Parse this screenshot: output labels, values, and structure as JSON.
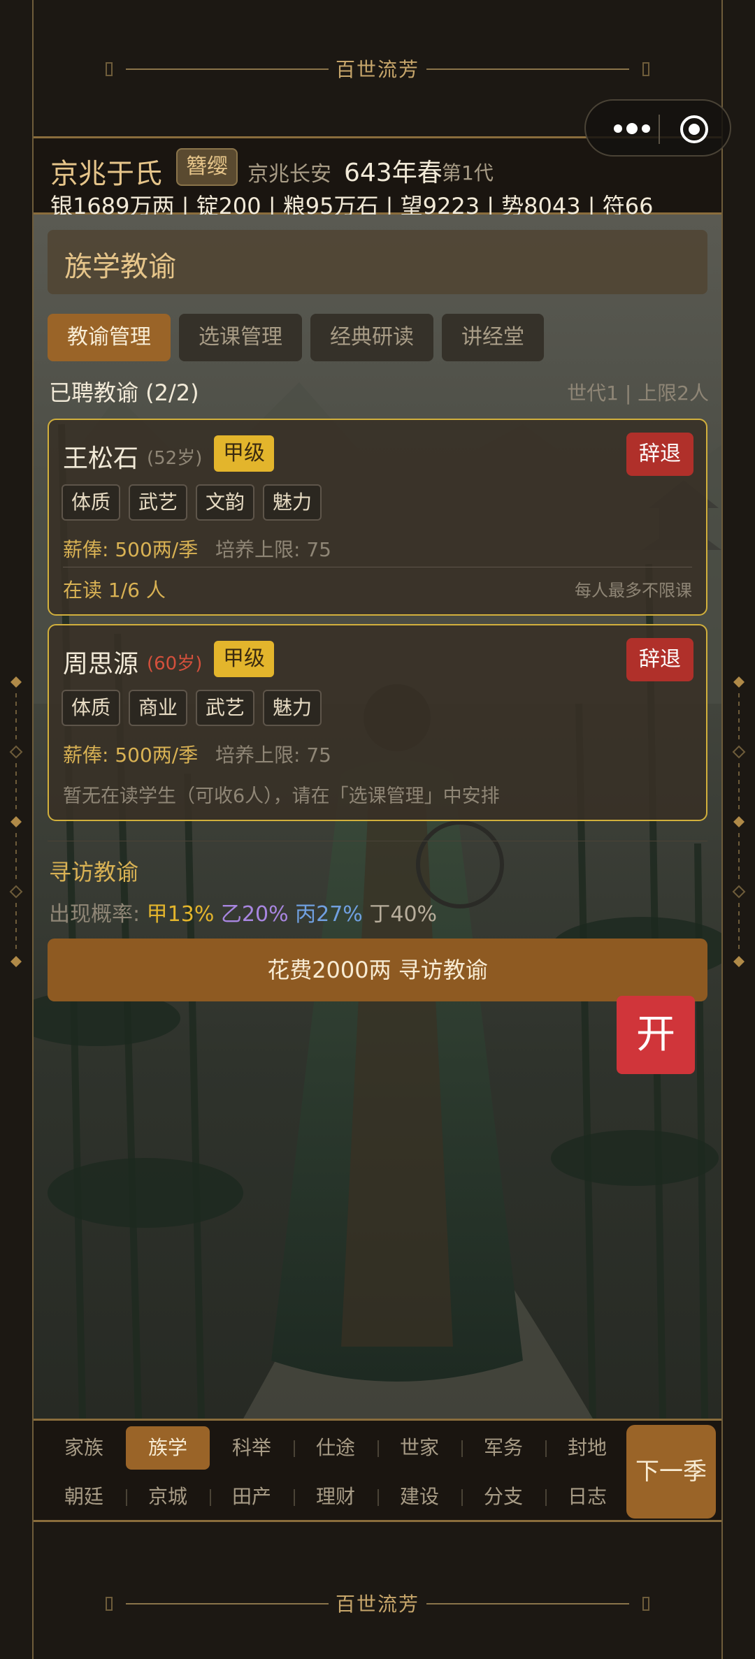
{
  "banner": {
    "title": "百世流芳"
  },
  "capsule": {
    "menu_icon": "more-dots-icon",
    "close_icon": "target-circle-icon"
  },
  "header": {
    "clan_name": "京兆于氏",
    "rank": "簪缨",
    "location": "京兆长安",
    "year": "643年春",
    "generation": "第1代",
    "stats": "银1689万两 | 锭200 | 粮95万石 | 望9223 | 势8043 | 符66"
  },
  "panel": {
    "title": "族学教谕",
    "tabs": [
      {
        "label": "教谕管理",
        "active": true
      },
      {
        "label": "选课管理",
        "active": false
      },
      {
        "label": "经典研读",
        "active": false
      },
      {
        "label": "讲经堂",
        "active": false
      }
    ],
    "hired_label": "已聘教谕 (2/2)",
    "hired_note": "世代1 | 上限2人"
  },
  "teachers": [
    {
      "name": "王松石",
      "age": "(52岁)",
      "grade": "甲级",
      "dismiss": "辞退",
      "tags": [
        "体质",
        "武艺",
        "文韵",
        "魅力"
      ],
      "salary": "薪俸: 500两/季",
      "cap": "培养上限: 75",
      "enrolled": "在读 1/6 人",
      "limit_note": "每人最多不限课"
    },
    {
      "name": "周思源",
      "age": "(60岁)",
      "grade": "甲级",
      "dismiss": "辞退",
      "tags": [
        "体质",
        "商业",
        "武艺",
        "魅力"
      ],
      "salary": "薪俸: 500两/季",
      "cap": "培养上限: 75",
      "empty_note": "暂无在读学生（可收6人），请在「选课管理」中安排"
    }
  ],
  "search": {
    "title": "寻访教谕",
    "prob_label": "出现概率: ",
    "p_jia": "甲13%",
    "p_yi": "乙20%",
    "p_bing": "丙27%",
    "p_ding": "丁40%",
    "button": "花费2000两 寻访教谕"
  },
  "open_button": "开",
  "nav": {
    "row1": [
      "家族",
      "族学",
      "科举",
      "仕途",
      "世家",
      "军务",
      "封地"
    ],
    "row2": [
      "朝廷",
      "京城",
      "田产",
      "理财",
      "建设",
      "分支",
      "日志"
    ],
    "active": "族学",
    "next": "下一季"
  },
  "colors": {
    "accent": "#9a6428",
    "gold": "#e3b52c",
    "danger": "#b0302a",
    "open_red": "#d0353a"
  }
}
